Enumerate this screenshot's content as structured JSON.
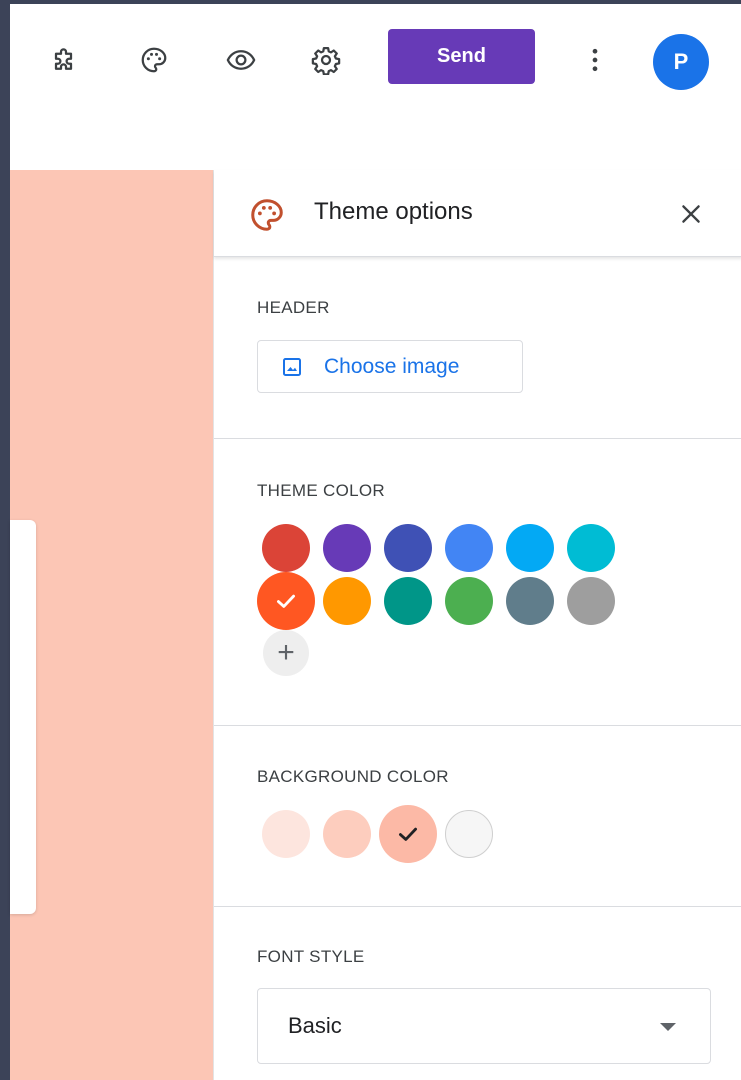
{
  "toolbar": {
    "icons": [
      "add-ons-puzzle-icon",
      "palette-icon",
      "eye-preview-icon",
      "gear-settings-icon",
      "more-vert-icon"
    ],
    "send_label": "Send",
    "avatar_initial": "P",
    "accent": "#673ab7"
  },
  "theme_panel": {
    "title": "Theme options",
    "header_section": {
      "label": "HEADER",
      "choose_image_label": "Choose image"
    },
    "theme_color_section": {
      "label": "THEME COLOR",
      "colors": [
        "#db4437",
        "#673ab7",
        "#3f51b5",
        "#4285f4",
        "#03a9f4",
        "#00bcd4",
        "#ff5722",
        "#ff9800",
        "#009688",
        "#4caf50",
        "#607d8b",
        "#9e9e9e"
      ],
      "selected_index": 6,
      "add_label": "+"
    },
    "background_color_section": {
      "label": "BACKGROUND COLOR",
      "colors": [
        "#fde5de",
        "#fdcdbe",
        "#fcb9a6",
        "#f6f6f6"
      ],
      "selected_index": 2
    },
    "font_style_section": {
      "label": "FONT STYLE",
      "selected_font": "Basic"
    }
  }
}
